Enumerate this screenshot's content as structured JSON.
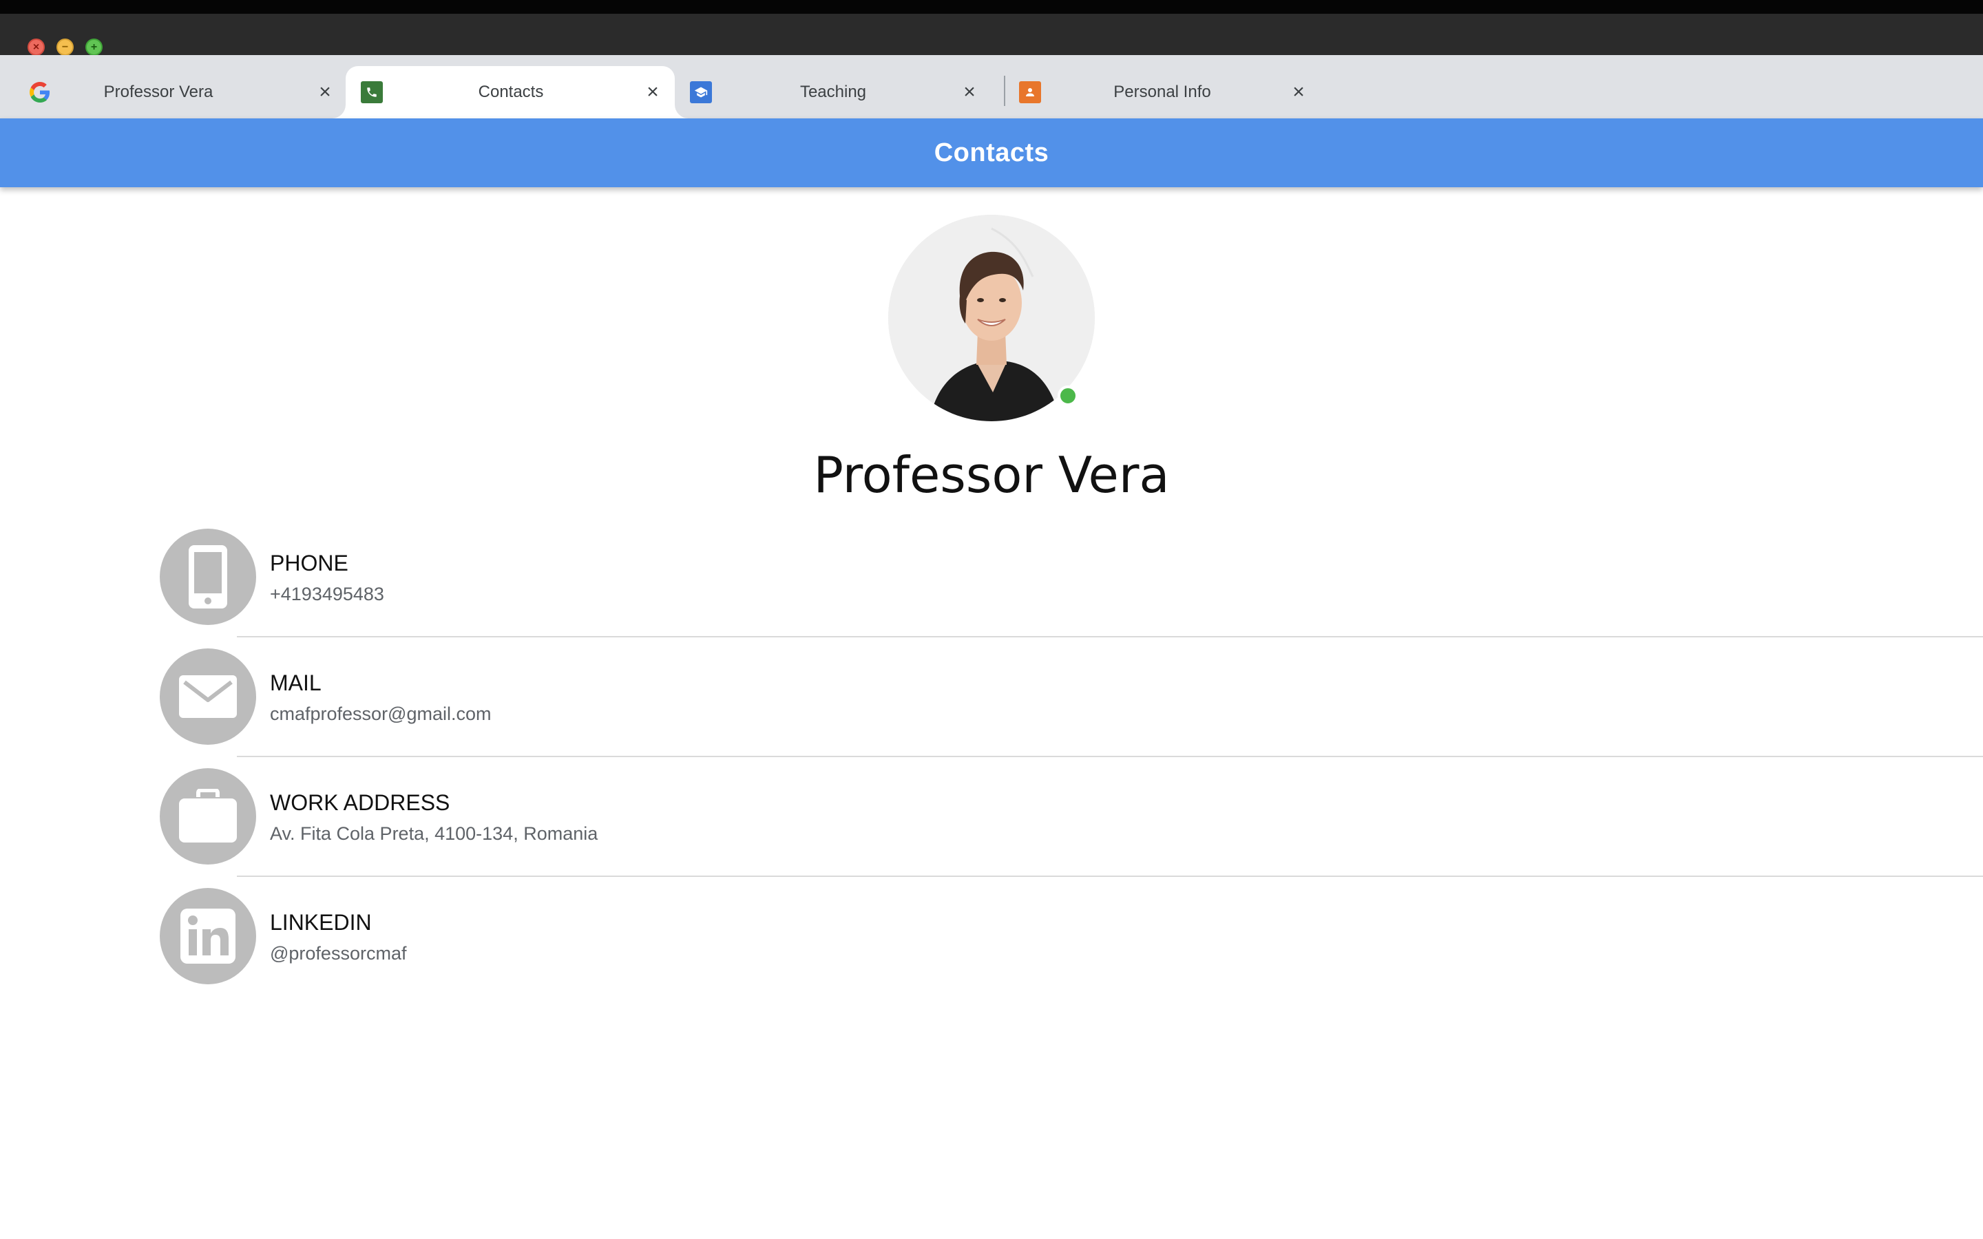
{
  "window": {
    "controls": [
      "close",
      "minimize",
      "maximize"
    ]
  },
  "tabs": [
    {
      "label": "Professor Vera",
      "favicon": "google-g-icon",
      "active": false
    },
    {
      "label": "Contacts",
      "favicon": "phone-favicon-icon",
      "active": true,
      "favicon_color": "#3a7b3a"
    },
    {
      "label": "Teaching",
      "favicon": "graduation-cap-icon",
      "active": false,
      "favicon_color": "#3b78d8"
    },
    {
      "label": "Personal Info",
      "favicon": "person-favicon-icon",
      "active": false,
      "favicon_color": "#e8762b"
    }
  ],
  "header": {
    "title": "Contacts",
    "color": "#5291e9"
  },
  "profile": {
    "name": "Professor Vera",
    "avatar": "profile-photo",
    "online": true,
    "status_color": "#4cb84a"
  },
  "contacts": [
    {
      "label": "PHONE",
      "value": "+4193495483",
      "icon": "smartphone-icon"
    },
    {
      "label": "MAIL",
      "value": "cmafprofessor@gmail.com",
      "icon": "envelope-icon"
    },
    {
      "label": "WORK ADDRESS",
      "value": "Av. Fita Cola Preta, 4100-134, Romania",
      "icon": "briefcase-icon"
    },
    {
      "label": "LINKEDIN",
      "value": "@professorcmaf",
      "icon": "linkedin-icon"
    }
  ]
}
